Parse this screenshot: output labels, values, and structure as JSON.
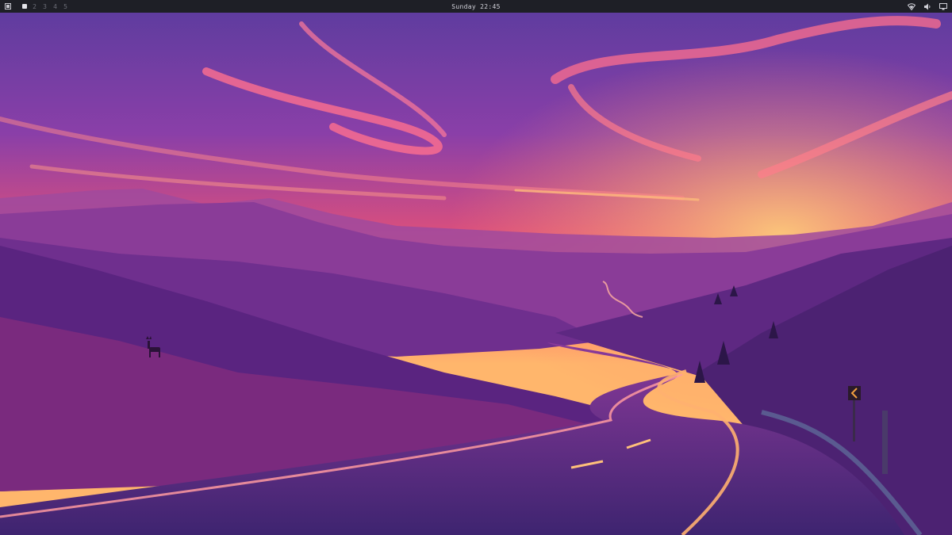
{
  "topbar": {
    "layout_icon": "window-layout-icon",
    "workspaces": [
      {
        "label": "",
        "active": true
      },
      {
        "label": "2",
        "active": false
      },
      {
        "label": "3",
        "active": false
      },
      {
        "label": "4",
        "active": false
      },
      {
        "label": "5",
        "active": false
      }
    ],
    "clock": {
      "day": "Sunday",
      "time": "22:45"
    },
    "tray": [
      "wifi-icon",
      "volume-icon",
      "display-icon"
    ]
  },
  "colors": {
    "bar_bg": "#1e1f26",
    "sky_top": "#5a3fa0",
    "sky_glow": "#ff7a6a",
    "horizon": "#ffb070",
    "hills": "#6a2e8e"
  }
}
